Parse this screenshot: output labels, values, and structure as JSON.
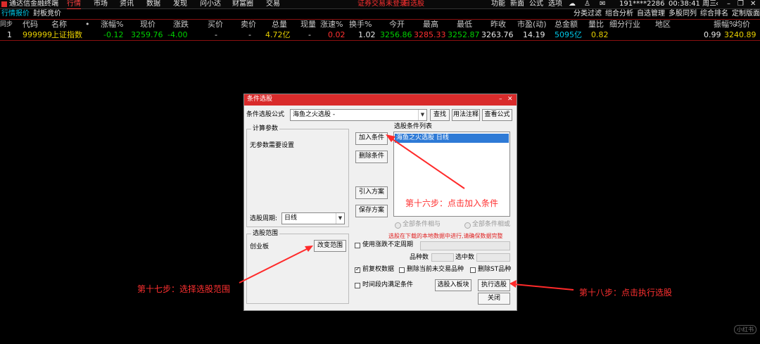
{
  "app": {
    "title": "通达信金融终端"
  },
  "topnav": [
    "行情",
    "市场",
    "资讯",
    "数据",
    "发现",
    "问小达",
    "财富圈",
    "交易"
  ],
  "notice": {
    "login": "证券交易未登录",
    "autoselect": "自选股"
  },
  "right_menu": [
    "功能",
    "新面",
    "公式",
    "选项"
  ],
  "user": "191****2286",
  "clock": "00:38:41 周三",
  "subtabs": [
    "行情报价",
    "封板竞价"
  ],
  "right_tabs": [
    "分类过滤",
    "组合分析",
    "自选管理",
    "多股同列",
    "综合排名",
    "定制版面"
  ],
  "table": {
    "corner": "同步",
    "headers": [
      "代码",
      "名称",
      "•",
      "涨幅%",
      "现价",
      "涨跌",
      "买价",
      "卖价",
      "总量",
      "现量",
      "涨速%",
      "换手%",
      "今开",
      "最高",
      "最低",
      "昨收",
      "市盈(动)",
      "总金额",
      "量比",
      "细分行业",
      "地区",
      "振幅%",
      "均价"
    ],
    "row": {
      "idx": "1",
      "code": "999999",
      "name": "上证指数",
      "chg_pct": "-0.12",
      "price": "3259.76",
      "chg": "-4.00",
      "bid": "-",
      "ask": "-",
      "vol": "4.72亿",
      "cur_vol": "-",
      "speed": "0.02",
      "turnover": "1.02",
      "open": "3256.86",
      "high": "3285.33",
      "low": "3252.87",
      "prev": "3263.76",
      "pe": "14.19",
      "amount": "5095亿",
      "vol_ratio": "0.82",
      "amplitude": "0.99",
      "avg": "3240.89"
    }
  },
  "dialog": {
    "title": "条件选股",
    "formula_label": "条件选股公式",
    "formula_value": "海鱼之火选股  -",
    "btn_find": "查找",
    "btn_usage": "用法注释",
    "btn_view": "查看公式",
    "params_title": "计算参数",
    "no_params": "无参数需要设置",
    "period_label": "选股周期:",
    "period_value": "日线",
    "btn_add": "加入条件",
    "btn_delete": "删除条件",
    "btn_import": "引入方案",
    "btn_save": "保存方案",
    "list_title": "选股条件列表",
    "list_items": [
      "海鱼之火选股  日线"
    ],
    "radio_and": "全部条件相与",
    "radio_or": "全部条件相或",
    "range_title": "选股范围",
    "range_value": "创业板",
    "btn_change_range": "改变范围",
    "warn": "选股在下载的本地数据中进行,请确保数据完整",
    "chk_irregular": "使用涨跌不定周期",
    "count_label": "品种数",
    "selected_label": "选中数",
    "chk_prefq": "前复权数据",
    "chk_exclude_today": "删除当前未交易品种",
    "chk_exclude_st": "删除ST品种",
    "chk_period_all": "时间段内满足条件",
    "btn_to_block": "选股入板块",
    "btn_execute": "执行选股",
    "btn_close": "关闭"
  },
  "annotations": {
    "step16": "第十六步：点击加入条件",
    "step17": "第十七步：选择选股范围",
    "step18": "第十八步：点击执行选股"
  },
  "watermark": "小红书"
}
